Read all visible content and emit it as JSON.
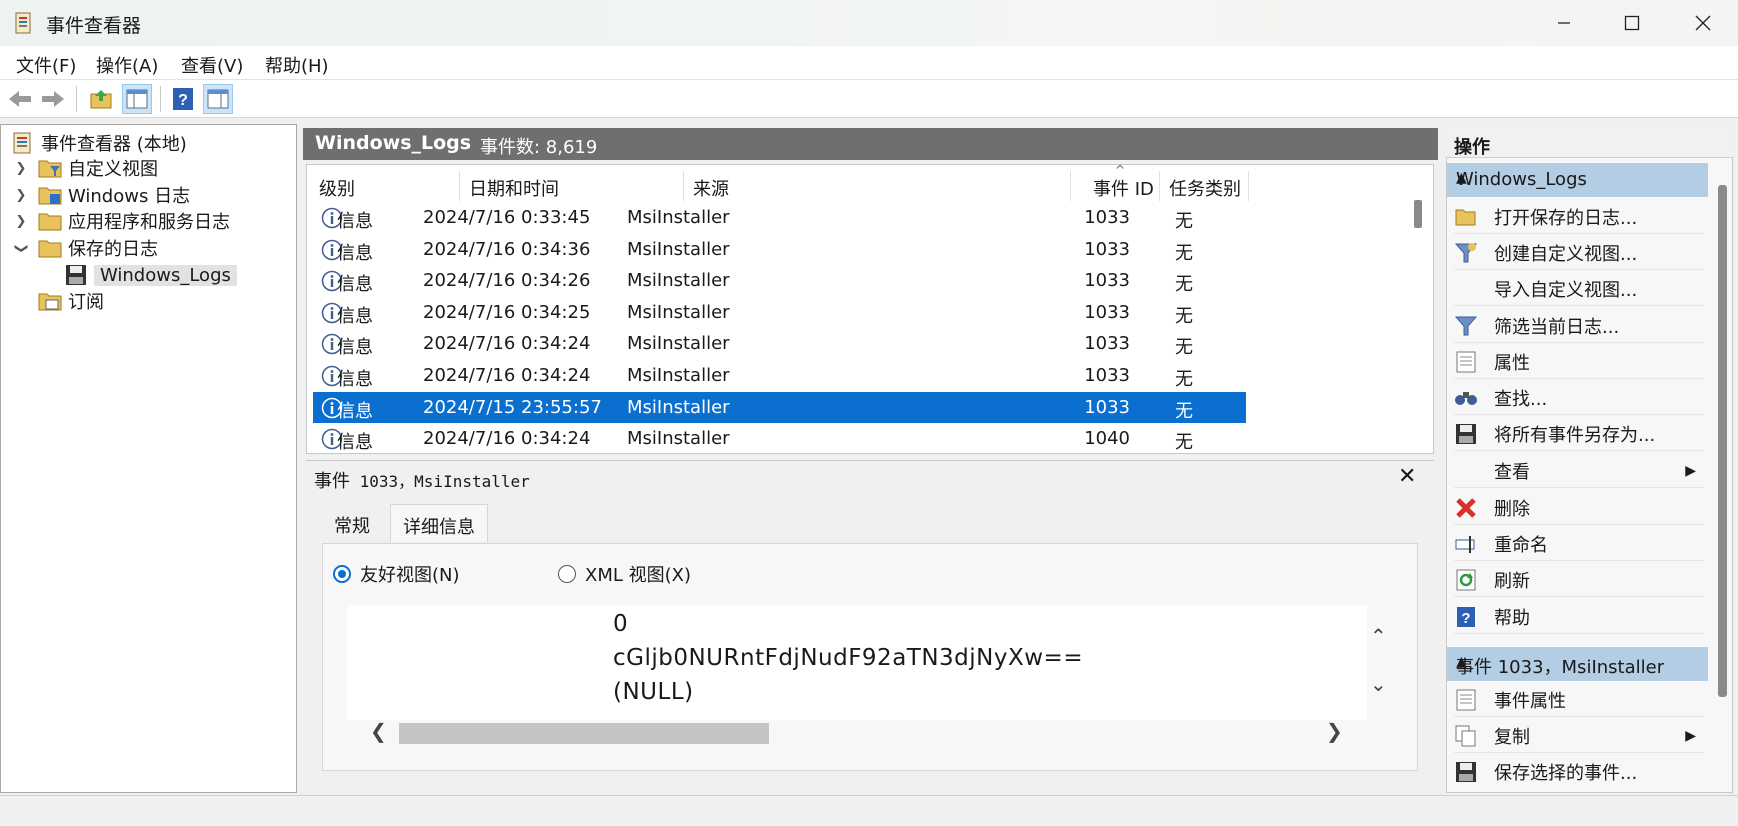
{
  "window": {
    "title": "事件查看器"
  },
  "menu": [
    "文件(F)",
    "操作(A)",
    "查看(V)",
    "帮助(H)"
  ],
  "tree": {
    "root": "事件查看器 (本地)",
    "items": [
      {
        "label": "自定义视图",
        "expanded": false
      },
      {
        "label": "Windows 日志",
        "expanded": false
      },
      {
        "label": "应用程序和服务日志",
        "expanded": false
      },
      {
        "label": "保存的日志",
        "expanded": true
      },
      {
        "label": "Windows_Logs",
        "selected": true
      },
      {
        "label": "订阅"
      }
    ]
  },
  "center": {
    "title": "Windows_Logs",
    "count": "事件数: 8,619",
    "columns": [
      "级别",
      "日期和时间",
      "来源",
      "事件 ID",
      "任务类别"
    ],
    "rows": [
      {
        "level": "信息",
        "datetime": "2024/7/16 0:33:45",
        "source": "MsiInstaller",
        "id": "1033",
        "task": "无"
      },
      {
        "level": "信息",
        "datetime": "2024/7/16 0:34:36",
        "source": "MsiInstaller",
        "id": "1033",
        "task": "无"
      },
      {
        "level": "信息",
        "datetime": "2024/7/16 0:34:26",
        "source": "MsiInstaller",
        "id": "1033",
        "task": "无"
      },
      {
        "level": "信息",
        "datetime": "2024/7/16 0:34:25",
        "source": "MsiInstaller",
        "id": "1033",
        "task": "无"
      },
      {
        "level": "信息",
        "datetime": "2024/7/16 0:34:24",
        "source": "MsiInstaller",
        "id": "1033",
        "task": "无"
      },
      {
        "level": "信息",
        "datetime": "2024/7/16 0:34:24",
        "source": "MsiInstaller",
        "id": "1033",
        "task": "无"
      },
      {
        "level": "信息",
        "datetime": "2024/7/15 23:55:57",
        "source": "MsiInstaller",
        "id": "1033",
        "task": "无",
        "selected": true
      },
      {
        "level": "信息",
        "datetime": "2024/7/16 0:34:24",
        "source": "MsiInstaller",
        "id": "1040",
        "task": "无"
      }
    ]
  },
  "detail": {
    "title_prefix": "事件",
    "title_rest": " 1033，MsiInstaller",
    "tabs": [
      "常规",
      "详细信息"
    ],
    "active_tab": "详细信息",
    "radio_friendly": "友好视图(N)",
    "radio_xml": "XML 视图(X)",
    "lines": [
      "0",
      "cGljb0NURntFdjNudF92aTN3djNyXw==",
      "(NULL)"
    ]
  },
  "actions": {
    "header": "操作",
    "section1": "Windows_Logs",
    "items1": [
      "打开保存的日志...",
      "创建自定义视图...",
      "导入自定义视图...",
      "筛选当前日志...",
      "属性",
      "查找...",
      "将所有事件另存为...",
      "查看",
      "删除",
      "重命名",
      "刷新",
      "帮助"
    ],
    "section2": "事件 1033，MsiInstaller",
    "items2": [
      "事件属性",
      "复制",
      "保存选择的事件..."
    ]
  }
}
